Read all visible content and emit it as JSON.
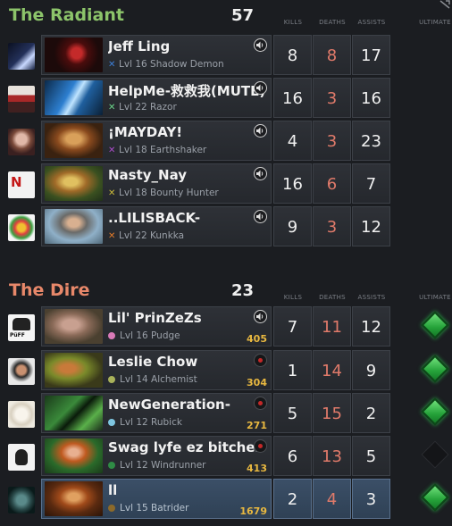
{
  "headers": {
    "kills": "KILLS",
    "deaths": "DEATHS",
    "assists": "ASSISTS",
    "ultimate": "ULTIMATE"
  },
  "colors": {
    "radiant": "#8cc46a",
    "dire": "#e8886a",
    "deaths": "#e07a6a",
    "gold": "#e8b840",
    "ult_ready": "#2bb84a"
  },
  "radiant": {
    "name": "The Radiant",
    "score": "57",
    "players": [
      {
        "name": "Jeff Ling",
        "level": "Lvl 16",
        "hero": "Shadow Demon",
        "kills": "8",
        "deaths": "8",
        "assists": "17",
        "mark_color": "#3d7fd6",
        "icon": "volume-icon"
      },
      {
        "name": "HelpMe-救救我(MUTE)",
        "level": "Lvl 22",
        "hero": "Razor",
        "kills": "16",
        "deaths": "3",
        "assists": "16",
        "mark_color": "#6bd68a",
        "icon": "volume-icon"
      },
      {
        "name": "¡MAYDAY!",
        "level": "Lvl 18",
        "hero": "Earthshaker",
        "kills": "4",
        "deaths": "3",
        "assists": "23",
        "mark_color": "#a94cc8",
        "icon": "volume-icon"
      },
      {
        "name": "Nasty_Nay",
        "level": "Lvl 18",
        "hero": "Bounty Hunter",
        "kills": "16",
        "deaths": "6",
        "assists": "7",
        "mark_color": "#c9b93a",
        "icon": "volume-icon"
      },
      {
        "name": "..LILISBACK-",
        "level": "Lvl 22",
        "hero": "Kunkka",
        "kills": "9",
        "deaths": "3",
        "assists": "12",
        "mark_color": "#e07b2a",
        "icon": "volume-icon"
      }
    ]
  },
  "dire": {
    "name": "The Dire",
    "score": "23",
    "players": [
      {
        "name": "Lil' PrinZeZs",
        "level": "Lvl 16",
        "hero": "Pudge",
        "gold": "405",
        "kills": "7",
        "deaths": "11",
        "assists": "12",
        "dot_color": "#d97ab8",
        "icon": "volume-icon",
        "ultimate_ready": true
      },
      {
        "name": "Leslie Chow",
        "level": "Lvl 14",
        "hero": "Alchemist",
        "gold": "304",
        "kills": "1",
        "deaths": "14",
        "assists": "9",
        "dot_color": "#a9b25a",
        "icon": "record-icon",
        "ultimate_ready": true
      },
      {
        "name": "NewGeneration-",
        "level": "Lvl 12",
        "hero": "Rubick",
        "gold": "271",
        "kills": "5",
        "deaths": "15",
        "assists": "2",
        "dot_color": "#7fc6e0",
        "icon": "record-icon",
        "ultimate_ready": true
      },
      {
        "name": "Swag lyfe ez bitches",
        "level": "Lvl 12",
        "hero": "Windrunner",
        "gold": "413",
        "kills": "6",
        "deaths": "13",
        "assists": "5",
        "dot_color": "#2f8c45",
        "icon": "record-icon",
        "ultimate_ready": false
      },
      {
        "name": "ll",
        "level": "Lvl 15",
        "hero": "Batrider",
        "gold": "1679",
        "kills": "2",
        "deaths": "4",
        "assists": "3",
        "dot_color": "#8c6a2a",
        "icon": "none",
        "ultimate_ready": true,
        "highlighted": true
      }
    ]
  }
}
